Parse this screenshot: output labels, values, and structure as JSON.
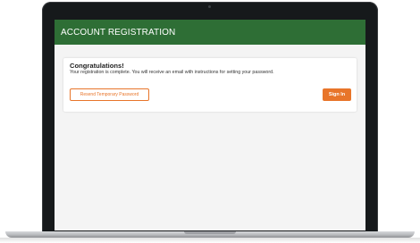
{
  "header": {
    "title": "ACCOUNT REGISTRATION"
  },
  "card": {
    "heading": "Congratulations!",
    "message": "Your registration is complete. You will receive an email with instructions for setting your password.",
    "resend_label": "Resend Temporary Password",
    "signin_label": "Sign In"
  },
  "colors": {
    "header_green": "#2e6e35",
    "accent_orange": "#e8752a"
  }
}
